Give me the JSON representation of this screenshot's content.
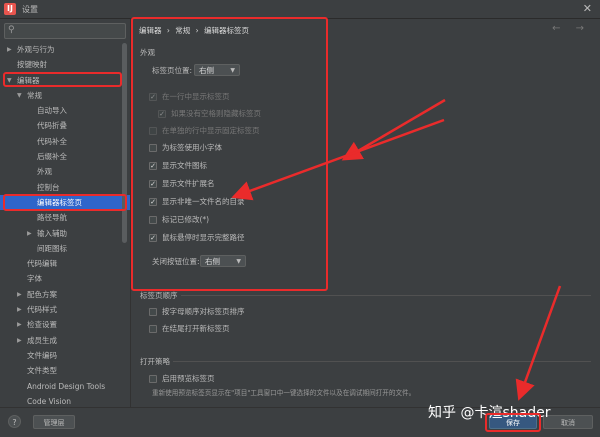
{
  "window": {
    "title": "设置",
    "close_glyph": "✕",
    "app_icon_letter": "IJ"
  },
  "search": {
    "placeholder": "",
    "icon": "search-icon"
  },
  "tree": [
    {
      "label": "外观与行为",
      "depth": 0,
      "arrow": "right"
    },
    {
      "label": "按键映射",
      "depth": 0,
      "arrow": ""
    },
    {
      "label": "编辑器",
      "depth": 0,
      "arrow": "down"
    },
    {
      "label": "常规",
      "depth": 1,
      "arrow": "down"
    },
    {
      "label": "自动导入",
      "depth": 2,
      "arrow": ""
    },
    {
      "label": "代码折叠",
      "depth": 2,
      "arrow": ""
    },
    {
      "label": "代码补全",
      "depth": 2,
      "arrow": ""
    },
    {
      "label": "后缀补全",
      "depth": 2,
      "arrow": ""
    },
    {
      "label": "外观",
      "depth": 2,
      "arrow": ""
    },
    {
      "label": "控制台",
      "depth": 2,
      "arrow": ""
    },
    {
      "label": "编辑器标签页",
      "depth": 2,
      "arrow": "",
      "selected": true
    },
    {
      "label": "路径导航",
      "depth": 2,
      "arrow": ""
    },
    {
      "label": "输入辅助",
      "depth": 2,
      "arrow": "right"
    },
    {
      "label": "间距图标",
      "depth": 2,
      "arrow": ""
    },
    {
      "label": "代码编辑",
      "depth": 1,
      "arrow": ""
    },
    {
      "label": "字体",
      "depth": 1,
      "arrow": ""
    },
    {
      "label": "配色方案",
      "depth": 1,
      "arrow": "right"
    },
    {
      "label": "代码样式",
      "depth": 1,
      "arrow": "right"
    },
    {
      "label": "检查设置",
      "depth": 1,
      "arrow": "right"
    },
    {
      "label": "成员生成",
      "depth": 1,
      "arrow": "right"
    },
    {
      "label": "文件编码",
      "depth": 1,
      "arrow": ""
    },
    {
      "label": "文件类型",
      "depth": 1,
      "arrow": ""
    },
    {
      "label": "Android Design Tools",
      "depth": 1,
      "arrow": ""
    },
    {
      "label": "Code Vision",
      "depth": 1,
      "arrow": ""
    }
  ],
  "breadcrumb": [
    "编辑器",
    "常规",
    "编辑器标签页"
  ],
  "breadcrumb_sep": "›",
  "nav_arrows": "← →",
  "appearance": {
    "heading": "外观",
    "tab_position_label": "标签页位置:",
    "tab_position_value": "右侧",
    "options": [
      {
        "label": "在一行中显示标签页",
        "checked": true,
        "disabled": true
      },
      {
        "label": "如果没有空格则隐藏标签页",
        "checked": true,
        "disabled": true
      },
      {
        "label": "在单独的行中显示固定标签页",
        "checked": false,
        "disabled": true
      },
      {
        "label": "为标签使用小字体",
        "checked": false,
        "disabled": false
      },
      {
        "label": "显示文件图标",
        "checked": true,
        "disabled": false
      },
      {
        "label": "显示文件扩展名",
        "checked": true,
        "disabled": false
      },
      {
        "label": "显示非唯一文件名的目录",
        "checked": true,
        "disabled": false
      },
      {
        "label": "标记已修改(*)",
        "checked": false,
        "disabled": false
      },
      {
        "label": "鼠标悬停时显示完整路径",
        "checked": true,
        "disabled": false
      }
    ],
    "close_button_label": "关闭按钮位置:",
    "close_button_value": "右侧"
  },
  "order": {
    "heading": "标签页顺序",
    "options": [
      {
        "label": "按字母顺序对标签页排序",
        "checked": false
      },
      {
        "label": "在结尾打开新标签页",
        "checked": false
      }
    ]
  },
  "opening": {
    "heading": "打开策略",
    "options": [
      {
        "label": "启用预览标签页",
        "checked": false
      }
    ],
    "hint": "重新使用预览标签页显示在\"项目\"工具窗口中一键选择的文件以及在调试期间打开的文件。"
  },
  "footer": {
    "help": "?",
    "manage_label": "管理层",
    "save_label": "保存",
    "cancel_label": "取消"
  },
  "watermark": "知乎 @卡渲shader",
  "colors": {
    "accent_selected": "#2f65ca",
    "annotation_red": "#ea2b2b",
    "primary_button": "#365880"
  }
}
